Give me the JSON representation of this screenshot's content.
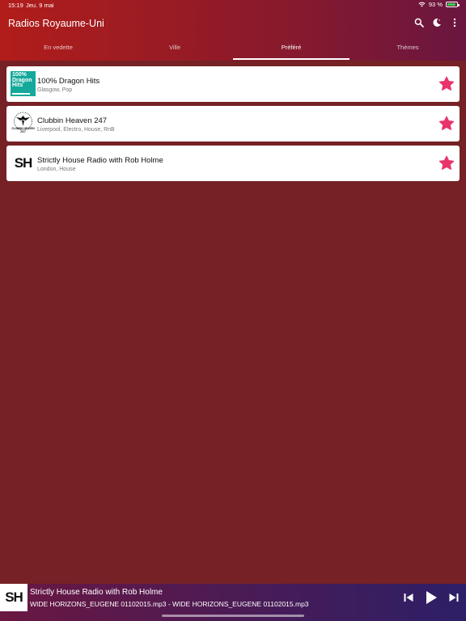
{
  "status": {
    "time": "15:19",
    "date": "Jeu. 9 mai",
    "battery": "93 %",
    "battery_level": 0.93
  },
  "header": {
    "title": "Radios Royaume-Uni"
  },
  "tabs": [
    {
      "label": "En vedette",
      "active": false
    },
    {
      "label": "Ville",
      "active": false
    },
    {
      "label": "Préféré",
      "active": true
    },
    {
      "label": "Thèmes",
      "active": false
    }
  ],
  "stations": [
    {
      "name": "100% Dragon Hits",
      "details": "Glasgow, Pop",
      "logo_text": "100% Dragon Hits",
      "favorite": true
    },
    {
      "name": "Clubbin Heaven 247",
      "details": "Liverpool, Electro, House, RnB",
      "logo_text": "CLUBBIN HEAVEN 24-7",
      "favorite": true
    },
    {
      "name": "Strictly House Radio with Rob Holme",
      "details": "London, House",
      "logo_text": "SH",
      "favorite": true
    }
  ],
  "player": {
    "logo_text": "SH",
    "title": "Strictly House Radio with Rob Holme",
    "track": "WIDE HORIZONS_EUGENE 01102015.mp3 - WIDE HORIZONS_EUGENE 01102015.mp3"
  },
  "colors": {
    "background": "#752125",
    "star": "#e8336b",
    "accent": "#b11d1a"
  }
}
